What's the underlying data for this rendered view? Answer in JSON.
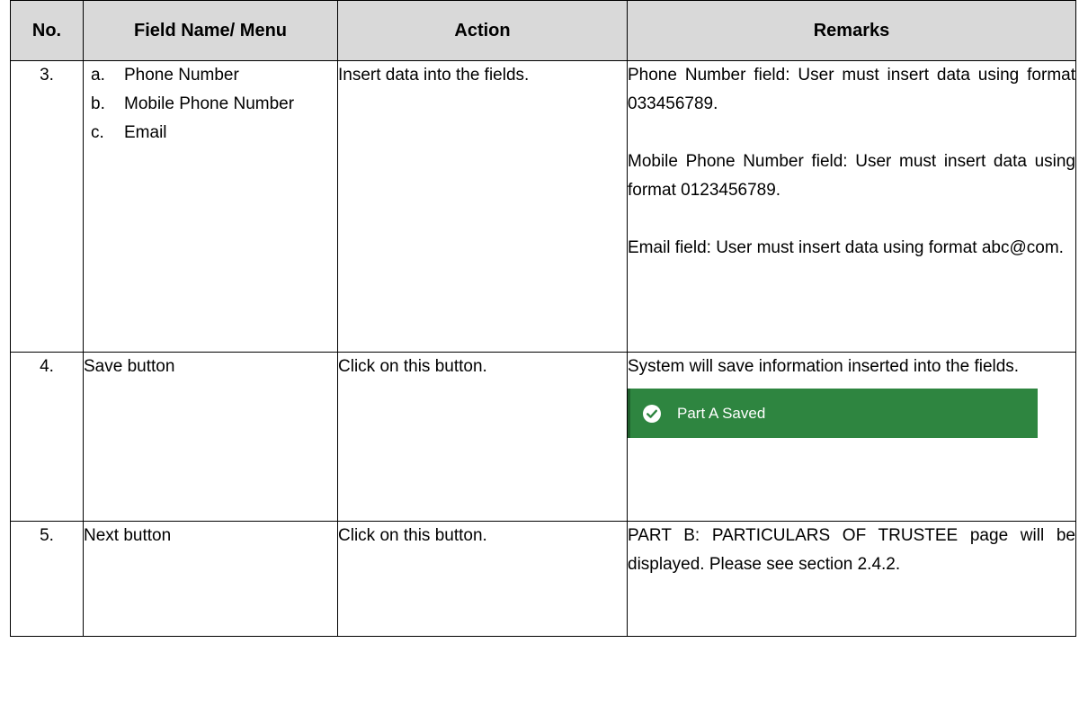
{
  "headers": {
    "no": "No.",
    "field": "Field Name/ Menu",
    "action": "Action",
    "remarks": "Remarks"
  },
  "rows": [
    {
      "no": "3.",
      "field_items": [
        {
          "marker": "a.",
          "text": "Phone Number"
        },
        {
          "marker": "b.",
          "text": "Mobile Phone Number"
        },
        {
          "marker": "c.",
          "text": "Email"
        }
      ],
      "action": "Insert data into the fields.",
      "remarks": [
        "Phone Number field: User must insert data using format 033456789.",
        "Mobile Phone Number field: User must insert data using format 0123456789.",
        "Email field: User must insert data using format abc@com."
      ]
    },
    {
      "no": "4.",
      "field": "Save button",
      "action": "Click on this button.",
      "remarks": [
        "System will save information inserted into the fields."
      ],
      "toast": {
        "text": "Part A Saved",
        "icon": "check-circle-icon",
        "color": "#2e8540"
      }
    },
    {
      "no": "5.",
      "field": "Next button",
      "action": "Click on this button.",
      "remarks": [
        "PART B: PARTICULARS OF TRUSTEE page will be displayed. Please see section 2.4.2."
      ]
    }
  ]
}
